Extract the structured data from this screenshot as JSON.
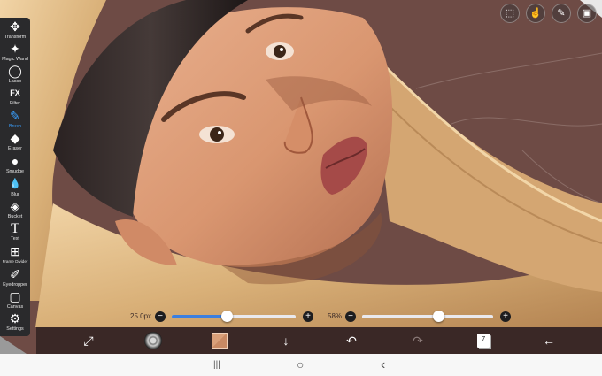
{
  "toolbox": {
    "tools": [
      {
        "name": "tool-transform",
        "label": "Transform",
        "icon": "move-arrows-icon",
        "glyph": "✥"
      },
      {
        "name": "tool-magic-wand",
        "label": "Magic Wand",
        "icon": "magic-wand-icon",
        "glyph": "✦"
      },
      {
        "name": "tool-lasso",
        "label": "Lasso",
        "icon": "lasso-icon",
        "glyph": "◯"
      },
      {
        "name": "tool-filter",
        "label": "Filter",
        "icon": "fx-icon",
        "glyph": "FX"
      },
      {
        "name": "tool-brush",
        "label": "Brush",
        "icon": "brush-icon",
        "glyph": "✎"
      },
      {
        "name": "tool-eraser",
        "label": "Eraser",
        "icon": "eraser-icon",
        "glyph": "◆"
      },
      {
        "name": "tool-smudge",
        "label": "Smudge",
        "icon": "smudge-icon",
        "glyph": "●"
      },
      {
        "name": "tool-blur",
        "label": "Blur",
        "icon": "blur-drop-icon",
        "glyph": "💧"
      },
      {
        "name": "tool-bucket",
        "label": "Bucket",
        "icon": "bucket-icon",
        "glyph": "◈"
      },
      {
        "name": "tool-text",
        "label": "Text",
        "icon": "text-icon",
        "glyph": "T"
      },
      {
        "name": "tool-frame-divider",
        "label": "Frame Divider",
        "icon": "frame-divider-icon",
        "glyph": "⊞"
      },
      {
        "name": "tool-eyedropper",
        "label": "Eyedropper",
        "icon": "eyedropper-icon",
        "glyph": "✐"
      },
      {
        "name": "tool-canvas",
        "label": "Canvas",
        "icon": "canvas-icon",
        "glyph": "▢"
      },
      {
        "name": "tool-settings",
        "label": "Settings",
        "icon": "gear-icon",
        "glyph": "⚙"
      }
    ],
    "active": "Brush",
    "active_color": "#3aa0ff"
  },
  "top_tools": {
    "selection": {
      "icon": "selection-icon",
      "glyph": "⬚"
    },
    "hand": {
      "icon": "hand-icon",
      "glyph": "☝"
    },
    "pen": {
      "icon": "pen-icon",
      "glyph": "✎"
    },
    "layers": {
      "icon": "layers-icon",
      "glyph": "▣"
    }
  },
  "brush_size": {
    "label": "25.0px",
    "value_fraction": 0.44,
    "minus": "−",
    "plus": "+"
  },
  "brush_opacity": {
    "label": "58%",
    "value_fraction": 0.58,
    "minus": "−",
    "plus": "+"
  },
  "actionbar": {
    "fit": {
      "icon": "fit-screen-icon",
      "glyph": "⤢"
    },
    "brush_thumbnail": {
      "icon": "brush-tip-icon"
    },
    "color": {
      "icon": "color-swatch",
      "value": "#d9a07a"
    },
    "download": {
      "icon": "arrow-down-icon",
      "glyph": "↓"
    },
    "undo": {
      "icon": "undo-icon",
      "glyph": "↶"
    },
    "redo": {
      "icon": "redo-icon",
      "glyph": "↷"
    },
    "layers_count": "7",
    "back": {
      "icon": "arrow-left-icon",
      "glyph": "←"
    }
  },
  "navbar": {
    "recents": "|||",
    "home": "○",
    "back": "‹"
  }
}
